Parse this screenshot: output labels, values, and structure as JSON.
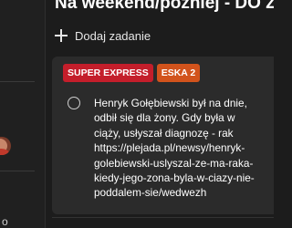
{
  "list": {
    "title": "Na weekend/później - DO Z..."
  },
  "add_task": {
    "label": "Dodaj zadanie",
    "icon": "plus-icon"
  },
  "sidebar": {
    "partial_text": "o"
  },
  "task": {
    "tags": [
      {
        "label": "SUPER EXPRESS",
        "color": "#c41e2b"
      },
      {
        "label": "ESKA 2",
        "color": "#d2531c"
      }
    ],
    "lines": [
      "Henryk Gołębiewski był na dnie,",
      "odbił się dla żony. Gdy była w",
      "ciąży, usłyszał diagnozę - rak",
      "https://plejada.pl/newsy/henryk-",
      "golebiewski-uslyszal-ze-ma-raka-",
      "kiedy-jego-zona-byla-w-ciazy-nie-",
      "poddalem-sie/wedwezh"
    ]
  },
  "colors": {
    "background": "#1c1c1c",
    "card": "#2b2b2b",
    "sidebar": "#202020"
  }
}
